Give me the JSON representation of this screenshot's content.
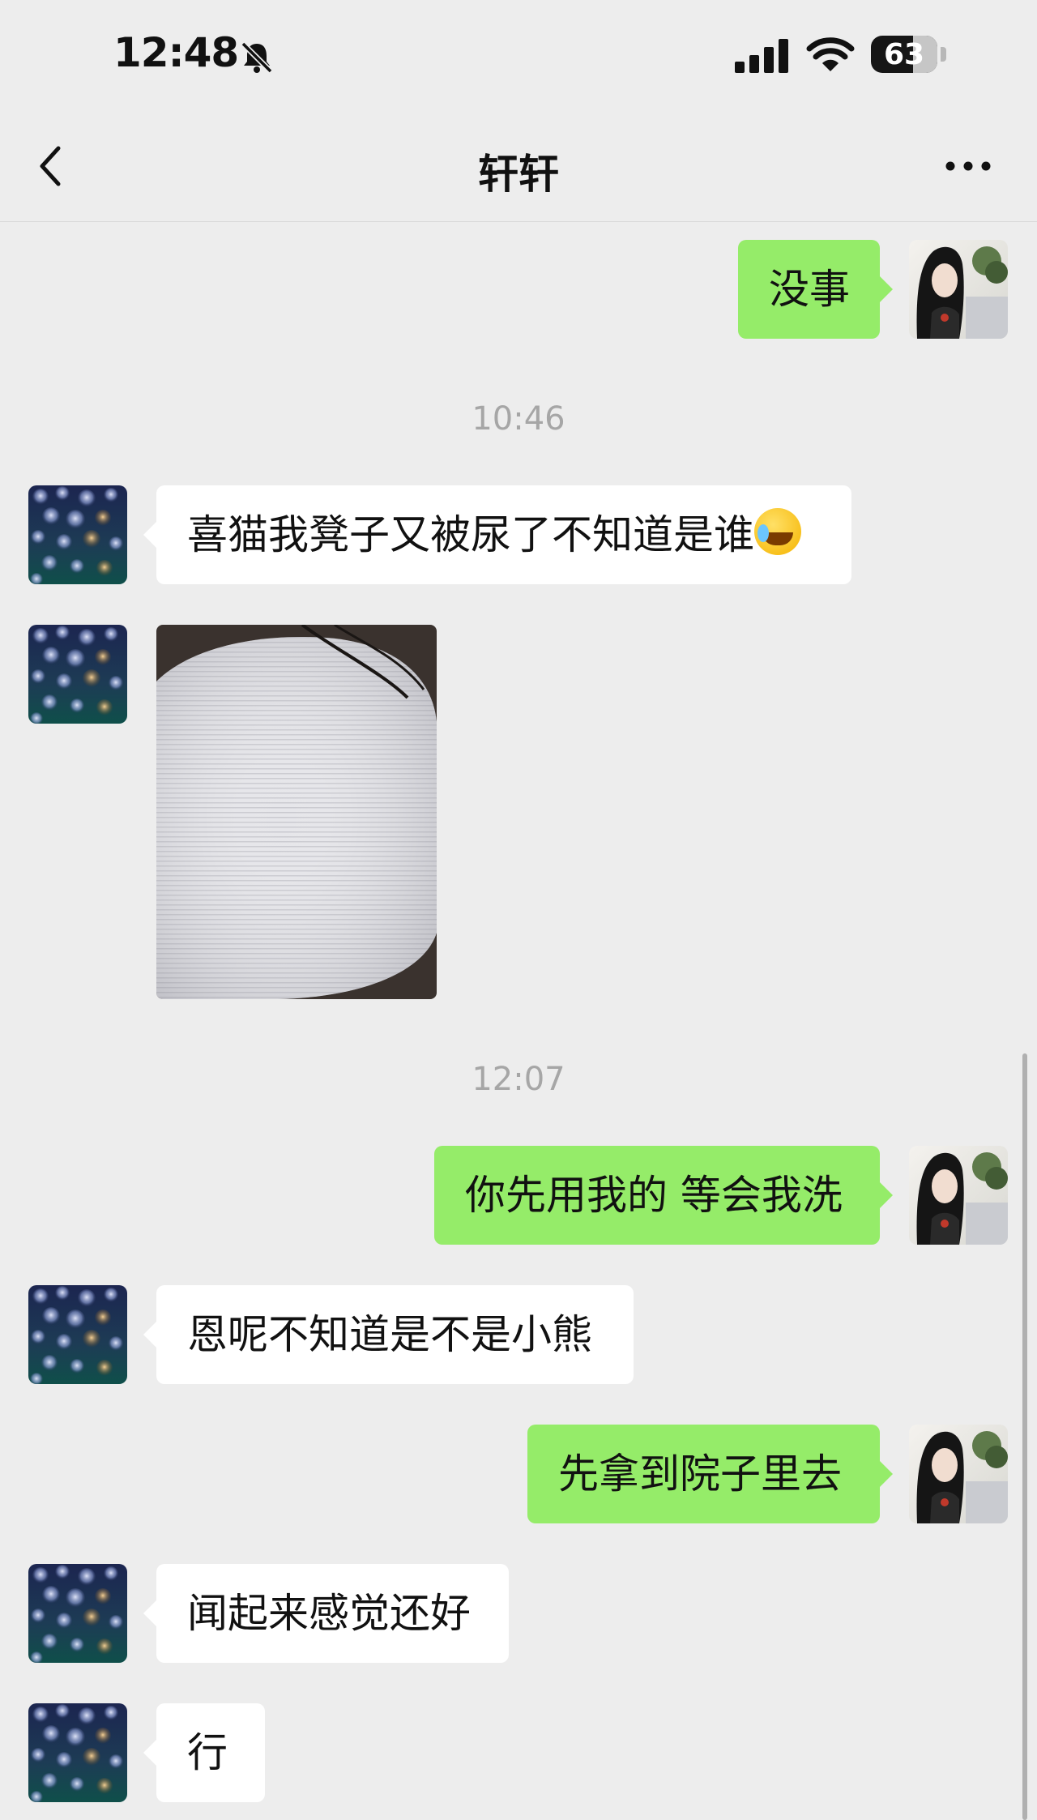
{
  "status_bar": {
    "time": "12:48",
    "battery_level": "63",
    "icons": [
      "bell-muted-icon",
      "cellular-signal-icon",
      "wifi-icon",
      "battery-icon"
    ]
  },
  "nav": {
    "title": "轩轩",
    "back_icon": "chevron-left-icon",
    "more_icon": "more-dots-icon"
  },
  "colors": {
    "background": "#ededed",
    "outgoing_bubble": "#95ec69",
    "incoming_bubble": "#ffffff",
    "timestamp_text": "#a6a6a6"
  },
  "messages": {
    "m1": {
      "side": "out",
      "text": "没事"
    },
    "t1": {
      "text": "10:46"
    },
    "m2": {
      "side": "in",
      "text": "喜猫我凳子又被尿了不知道是谁",
      "emoji": "crying-laughing-emoji"
    },
    "m3": {
      "side": "in",
      "type": "image",
      "description_icon": "chair-photo"
    },
    "t2": {
      "text": "12:07"
    },
    "m4": {
      "side": "out",
      "text": "你先用我的 等会我洗"
    },
    "m5": {
      "side": "in",
      "text": "恩呢不知道是不是小熊"
    },
    "m6": {
      "side": "out",
      "text": "先拿到院子里去"
    },
    "m7": {
      "side": "in",
      "text": "闻起来感觉还好"
    },
    "m8": {
      "side": "in",
      "text": "行"
    }
  }
}
